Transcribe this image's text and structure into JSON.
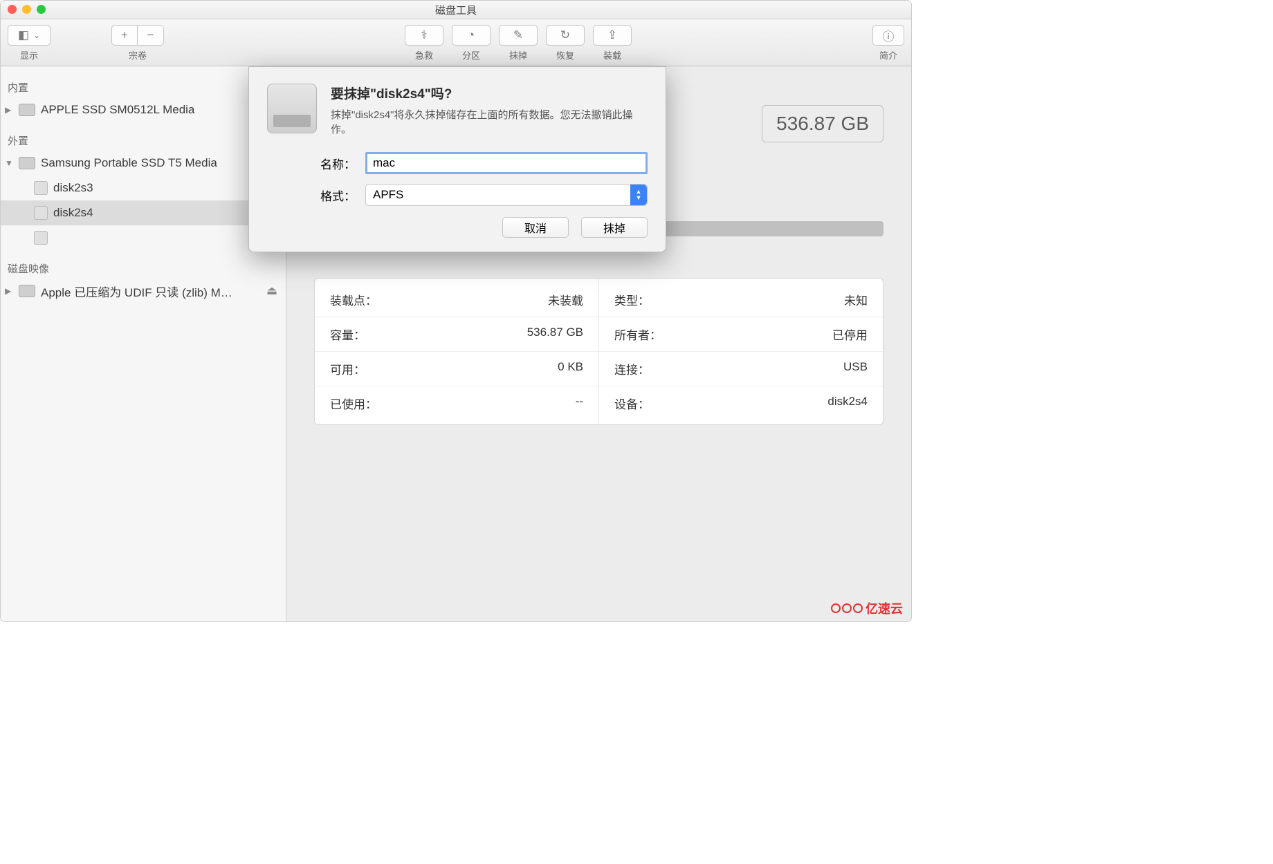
{
  "window_title": "磁盘工具",
  "toolbar": {
    "view_label": "显示",
    "volume_label": "宗卷",
    "add": "+",
    "remove": "−",
    "firstaid": {
      "label": "急救"
    },
    "partition": {
      "label": "分区"
    },
    "erase": {
      "label": "抹掉"
    },
    "restore": {
      "label": "恢复"
    },
    "mount": {
      "label": "装载"
    },
    "info": {
      "label": "简介"
    }
  },
  "sidebar": {
    "internal_header": "内置",
    "internal": [
      {
        "name": "APPLE SSD SM0512L Media"
      }
    ],
    "external_header": "外置",
    "external": [
      {
        "name": "Samsung Portable SSD T5 Media"
      }
    ],
    "children": [
      {
        "name": "disk2s3"
      },
      {
        "name": "disk2s4"
      }
    ],
    "images_header": "磁盘映像",
    "images": [
      {
        "name": "Apple 已压缩为 UDIF 只读 (zlib) M…"
      }
    ]
  },
  "capacity_badge": "536.87 GB",
  "info_left": [
    {
      "k": "装载点：",
      "v": "未装载"
    },
    {
      "k": "容量：",
      "v": "536.87 GB"
    },
    {
      "k": "可用：",
      "v": "0 KB"
    },
    {
      "k": "已使用：",
      "v": "--"
    }
  ],
  "info_right": [
    {
      "k": "类型：",
      "v": "未知"
    },
    {
      "k": "所有者：",
      "v": "已停用"
    },
    {
      "k": "连接：",
      "v": "USB"
    },
    {
      "k": "设备：",
      "v": "disk2s4"
    }
  ],
  "dialog": {
    "heading": "要抹掉\"disk2s4\"吗?",
    "description": "抹掉\"disk2s4\"将永久抹掉储存在上面的所有数据。您无法撤销此操作。",
    "name_label": "名称：",
    "name_value": "mac",
    "format_label": "格式：",
    "format_value": "APFS",
    "cancel": "取消",
    "erase": "抹掉"
  },
  "watermark": "亿速云"
}
